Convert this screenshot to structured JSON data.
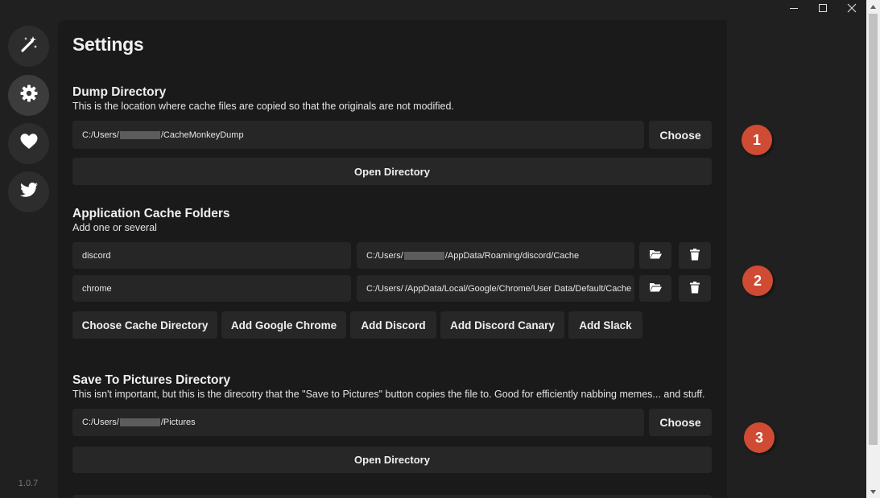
{
  "app": {
    "version": "1.0.7",
    "nav": [
      {
        "name": "magic-wand-icon",
        "active": false
      },
      {
        "name": "gear-icon",
        "active": true
      },
      {
        "name": "heart-icon",
        "active": false
      },
      {
        "name": "twitter-icon",
        "active": false
      }
    ]
  },
  "page": {
    "title": "Settings"
  },
  "dump": {
    "title": "Dump Directory",
    "description": "This is the location where cache files are copied so that the originals are not modified.",
    "path_prefix": "C:/Users/",
    "path_suffix": "/CacheMonkeyDump",
    "choose_label": "Choose",
    "open_label": "Open Directory"
  },
  "cache": {
    "title": "Application Cache Folders",
    "description": "Add one or several",
    "rows": [
      {
        "name": "discord",
        "path_prefix": "C:/Users/",
        "path_suffix": "/AppData/Roaming/discord/Cache"
      },
      {
        "name": "chrome",
        "path_prefix": "C:/Users/",
        "path_suffix": "/AppData/Local/Google/Chrome/User Data/Default/Cache"
      }
    ],
    "buttons": {
      "choose_dir": "Choose Cache Directory",
      "add_chrome": "Add Google Chrome",
      "add_discord": "Add Discord",
      "add_canary": "Add Discord Canary",
      "add_slack": "Add Slack"
    }
  },
  "pictures": {
    "title": "Save To Pictures Directory",
    "description": "This isn't important, but this is the direcotry that the \"Save to Pictures\" button copies the file to. Good for efficiently nabbing memes... and stuff.",
    "path_prefix": "C:/Users/",
    "path_suffix": "/Pictures",
    "choose_label": "Choose",
    "open_label": "Open Directory"
  },
  "annotations": [
    "1",
    "2",
    "3"
  ],
  "colors": {
    "background": "#202020",
    "panel": "#1a1a1a",
    "control": "#262626",
    "badge": "#cf4b34"
  }
}
